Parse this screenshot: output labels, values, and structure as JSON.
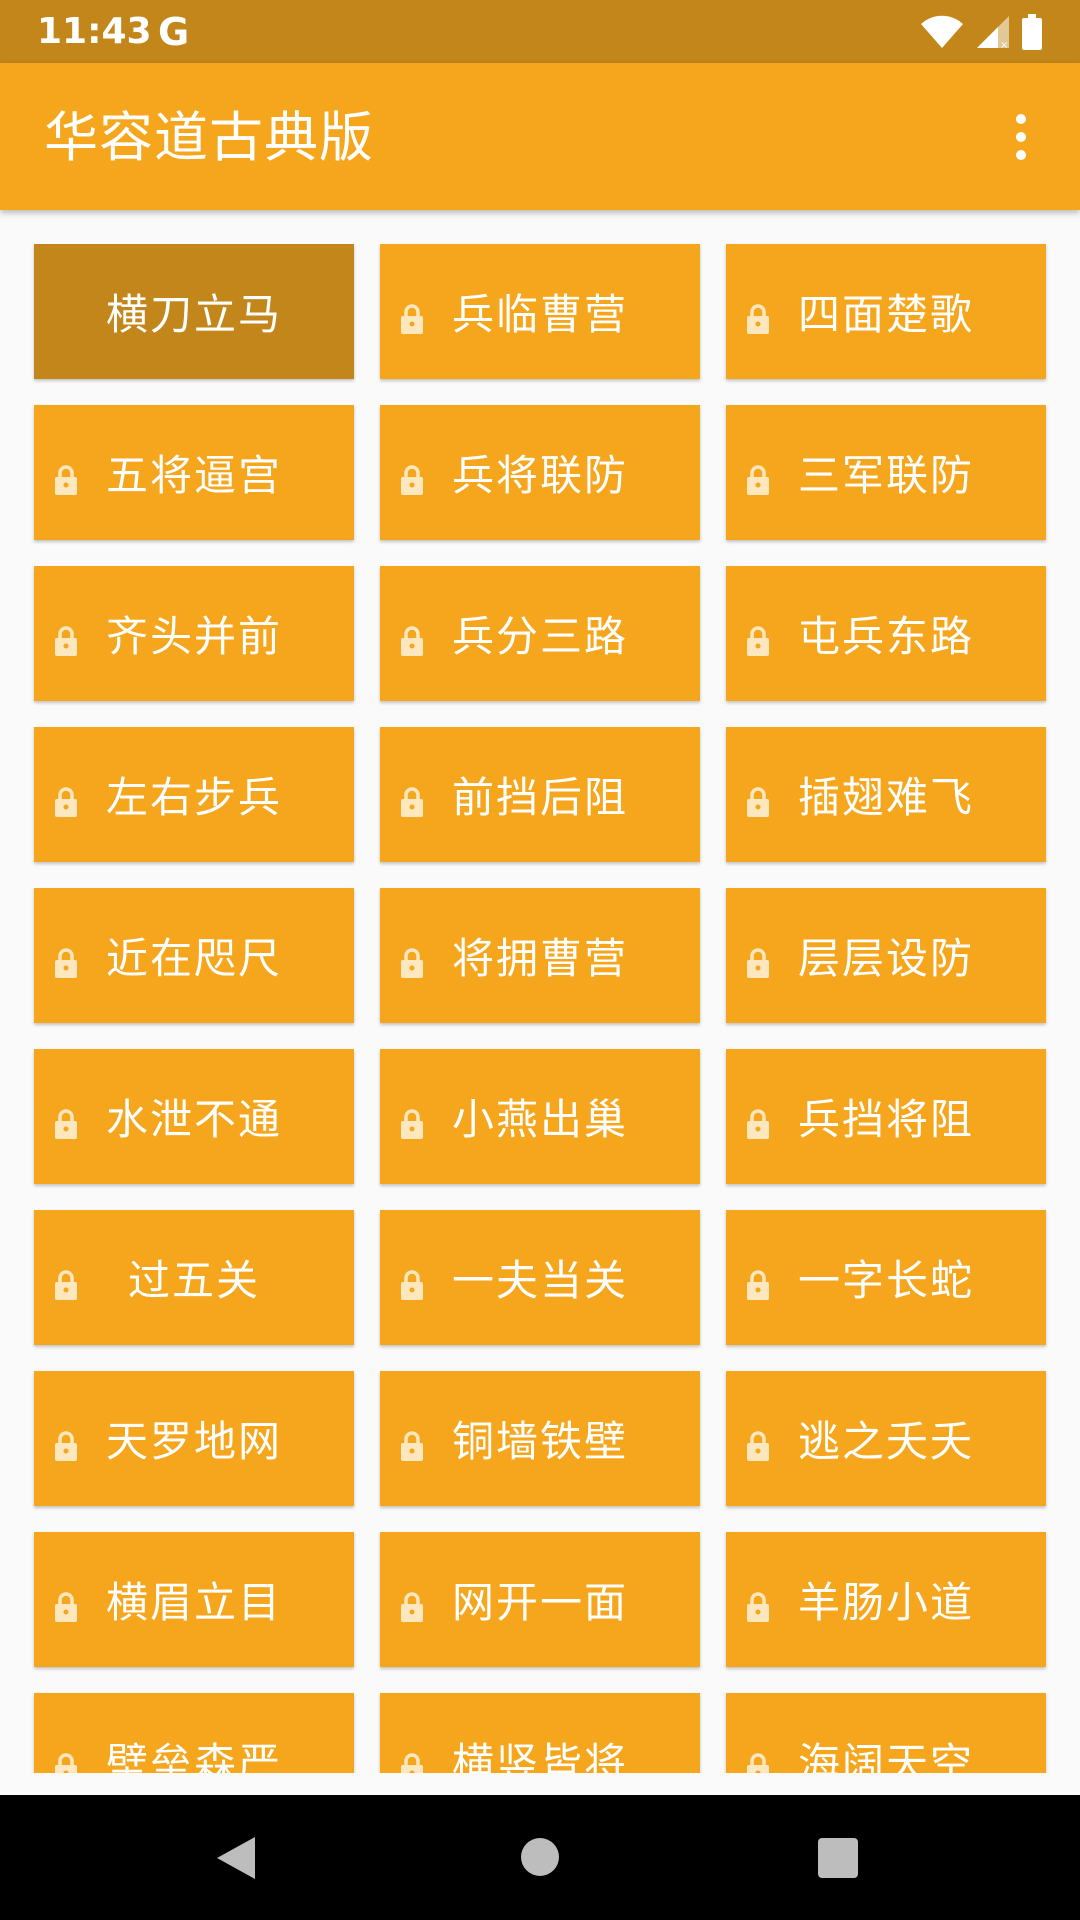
{
  "status_bar": {
    "time": "11:43",
    "google_icon": "G",
    "icons": [
      "wifi-icon",
      "signal-icon",
      "battery-icon"
    ]
  },
  "app_bar": {
    "title": "华容道古典版",
    "menu_icon": "more-vert-icon"
  },
  "colors": {
    "primary": "#F5A61D",
    "primary_dark": "#C2861A",
    "text_on_primary": "#FFFFFF",
    "background": "#FAFAFA"
  },
  "levels": [
    {
      "name": "横刀立马",
      "locked": false,
      "current": true
    },
    {
      "name": "兵临曹营",
      "locked": true
    },
    {
      "name": "四面楚歌",
      "locked": true
    },
    {
      "name": "五将逼宫",
      "locked": true
    },
    {
      "name": "兵将联防",
      "locked": true
    },
    {
      "name": "三军联防",
      "locked": true
    },
    {
      "name": "齐头并前",
      "locked": true
    },
    {
      "name": "兵分三路",
      "locked": true
    },
    {
      "name": "屯兵东路",
      "locked": true
    },
    {
      "name": "左右步兵",
      "locked": true
    },
    {
      "name": "前挡后阻",
      "locked": true
    },
    {
      "name": "插翅难飞",
      "locked": true
    },
    {
      "name": "近在咫尺",
      "locked": true
    },
    {
      "name": "将拥曹营",
      "locked": true
    },
    {
      "name": "层层设防",
      "locked": true
    },
    {
      "name": "水泄不通",
      "locked": true
    },
    {
      "name": "小燕出巢",
      "locked": true
    },
    {
      "name": "兵挡将阻",
      "locked": true
    },
    {
      "name": "过五关",
      "locked": true
    },
    {
      "name": "一夫当关",
      "locked": true
    },
    {
      "name": "一字长蛇",
      "locked": true
    },
    {
      "name": "天罗地网",
      "locked": true
    },
    {
      "name": "铜墙铁壁",
      "locked": true
    },
    {
      "name": "逃之夭夭",
      "locked": true
    },
    {
      "name": "横眉立目",
      "locked": true
    },
    {
      "name": "网开一面",
      "locked": true
    },
    {
      "name": "羊肠小道",
      "locked": true
    },
    {
      "name": "壁垒森严",
      "locked": true
    },
    {
      "name": "横竖皆将",
      "locked": true
    },
    {
      "name": "海阔天空",
      "locked": true
    }
  ],
  "nav_bar": {
    "buttons": [
      "back-icon",
      "home-icon",
      "recents-icon"
    ]
  }
}
